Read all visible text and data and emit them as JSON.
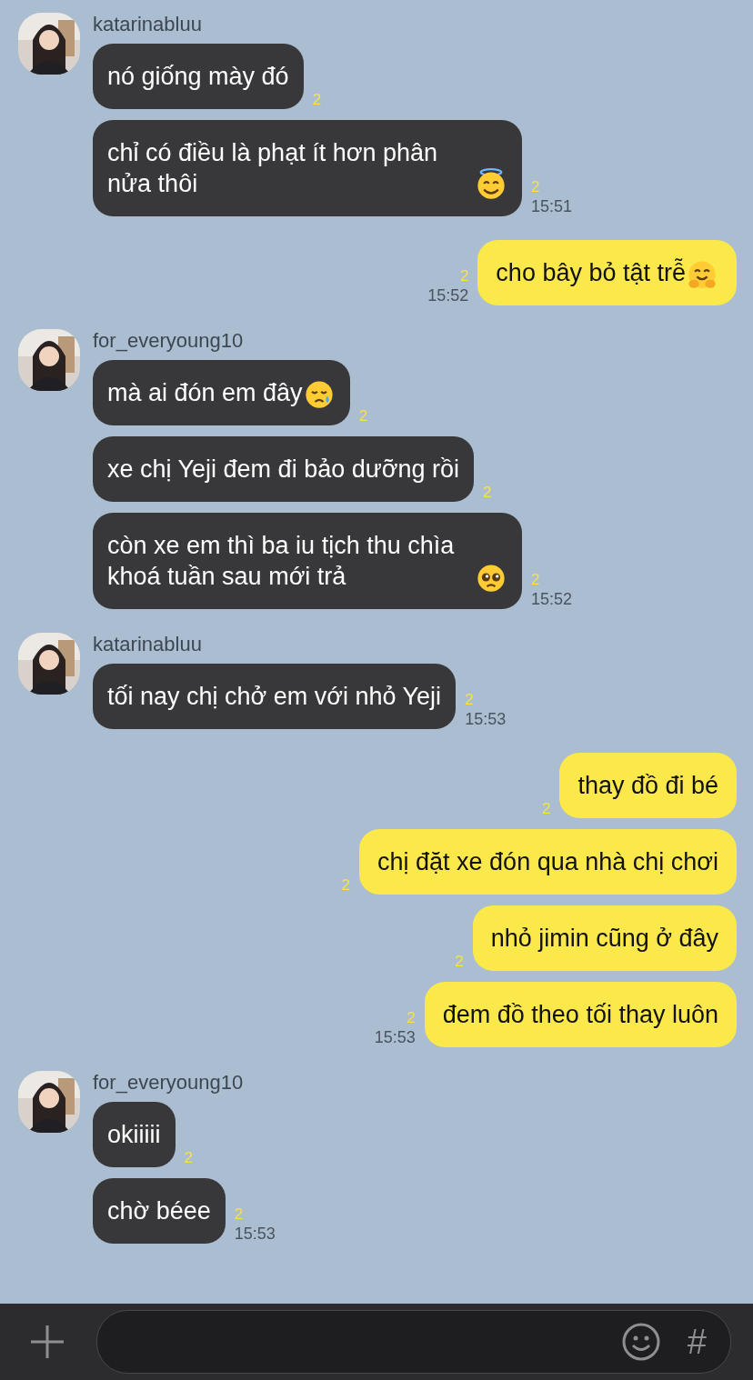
{
  "groups": [
    {
      "kind": "incoming",
      "sender": "katarinabluu",
      "messages": [
        {
          "text": "nó giống mày đó",
          "kind": "plain",
          "unread": "2"
        },
        {
          "text": "chỉ có điều là phạt ít hơn phân nửa thôi",
          "kind": "halo",
          "unread": "2",
          "time": "15:51"
        }
      ]
    },
    {
      "kind": "outgoing",
      "messages": [
        {
          "text": "cho bây bỏ tật trễ",
          "kind": "hug",
          "unread": "2",
          "time": "15:52"
        }
      ]
    },
    {
      "kind": "incoming",
      "sender": "for_everyoung10",
      "messages": [
        {
          "text": "mà ai đón em đây",
          "kind": "tear",
          "unread": "2"
        },
        {
          "text": "xe chị Yeji đem đi bảo dưỡng rồi",
          "kind": "plain",
          "unread": "2"
        },
        {
          "text": "còn xe em thì ba iu tịch thu chìa khoá tuần sau mới trả",
          "kind": "pleading",
          "unread": "2",
          "time": "15:52"
        }
      ]
    },
    {
      "kind": "incoming",
      "sender": "katarinabluu",
      "messages": [
        {
          "text": "tối nay chị chở em với nhỏ Yeji",
          "kind": "plain",
          "unread": "2",
          "time": "15:53"
        }
      ]
    },
    {
      "kind": "outgoing",
      "messages": [
        {
          "text": "thay đồ đi bé",
          "kind": "plain",
          "unread": "2"
        },
        {
          "text": "chị đặt xe đón qua nhà chị chơi",
          "kind": "plain",
          "unread": "2"
        },
        {
          "text": "nhỏ jimin cũng ở đây",
          "kind": "plain",
          "unread": "2"
        },
        {
          "text": "đem đồ theo tối thay luôn",
          "kind": "plain",
          "unread": "2",
          "time": "15:53"
        }
      ]
    },
    {
      "kind": "incoming",
      "sender": "for_everyoung10",
      "messages": [
        {
          "text": "okiiiii",
          "kind": "plain",
          "unread": "2"
        },
        {
          "text": "chờ béee",
          "kind": "plain",
          "unread": "2",
          "time": "15:53"
        }
      ]
    }
  ],
  "input_bar": {
    "hash_key": "#"
  }
}
